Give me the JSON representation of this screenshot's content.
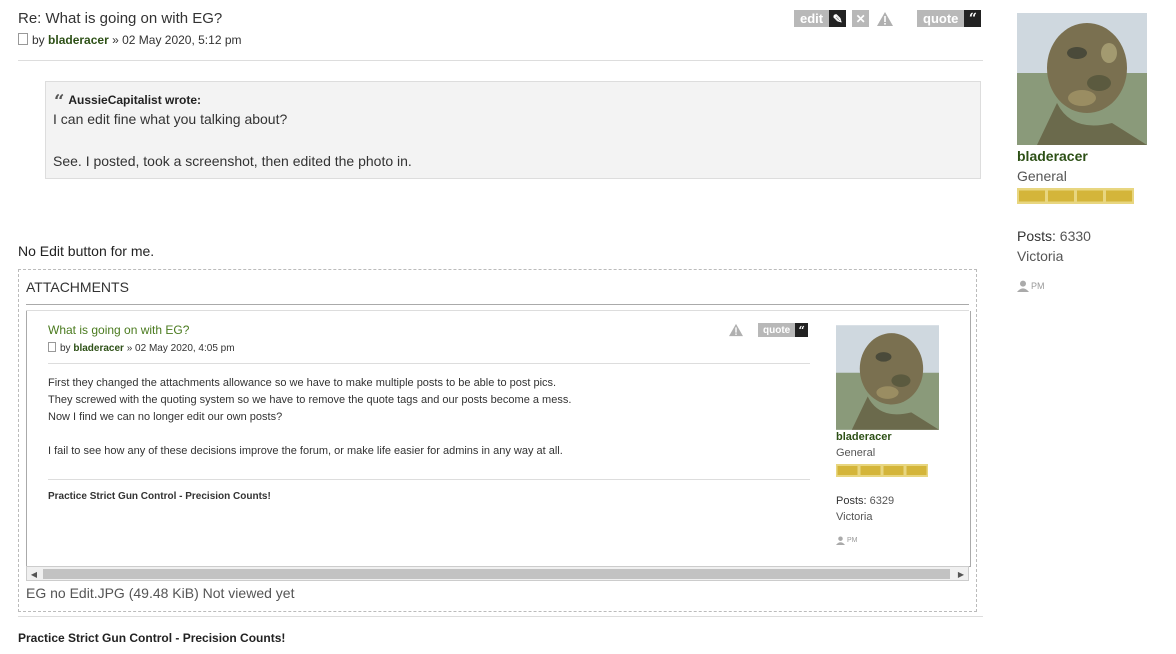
{
  "post": {
    "title": "Re: What is going on with EG?",
    "by_label": "by",
    "author": "bladeracer",
    "date": "» 02 May 2020, 5:12 pm",
    "buttons": {
      "edit": "edit",
      "quote": "quote"
    },
    "quote": {
      "author_line": "AussieCapitalist wrote:",
      "line1": "I can edit fine what you talking about?",
      "line2": "See. I posted, took a screenshot, then edited the photo in."
    },
    "body": "No Edit button for me.",
    "signature": "Practice Strict Gun Control - Precision Counts!"
  },
  "attachments": {
    "title": "ATTACHMENTS",
    "file_label": "EG no Edit.JPG (49.48 KiB) Not viewed yet",
    "image": {
      "title": "What is going on with EG?",
      "by_label": "by",
      "author": "bladeracer",
      "date": "» 02 May 2020, 4:05 pm",
      "quote_label": "quote",
      "lines": [
        "First they changed the attachments allowance so we have to make multiple posts to be able to post pics.",
        "They screwed with the quoting system so we have to remove the quote tags and our posts become a mess.",
        "Now I find we can no longer edit our own posts?",
        "",
        "I fail to see how any of these decisions improve the forum, or make life easier for admins in any way at all."
      ],
      "signature": "Practice Strict Gun Control - Precision Counts!",
      "profile": {
        "username": "bladeracer",
        "rank": "General",
        "posts_label": "Posts:",
        "posts": "6329",
        "location": "Victoria",
        "pm": "PM"
      }
    }
  },
  "profile": {
    "username": "bladeracer",
    "rank": "General",
    "posts_label": "Posts:",
    "posts": "6330",
    "location": "Victoria",
    "pm": "PM"
  },
  "colors": {
    "username": "#2d5016",
    "rank_bar": "#d4b53a",
    "button_bg": "#b8b8b8"
  }
}
